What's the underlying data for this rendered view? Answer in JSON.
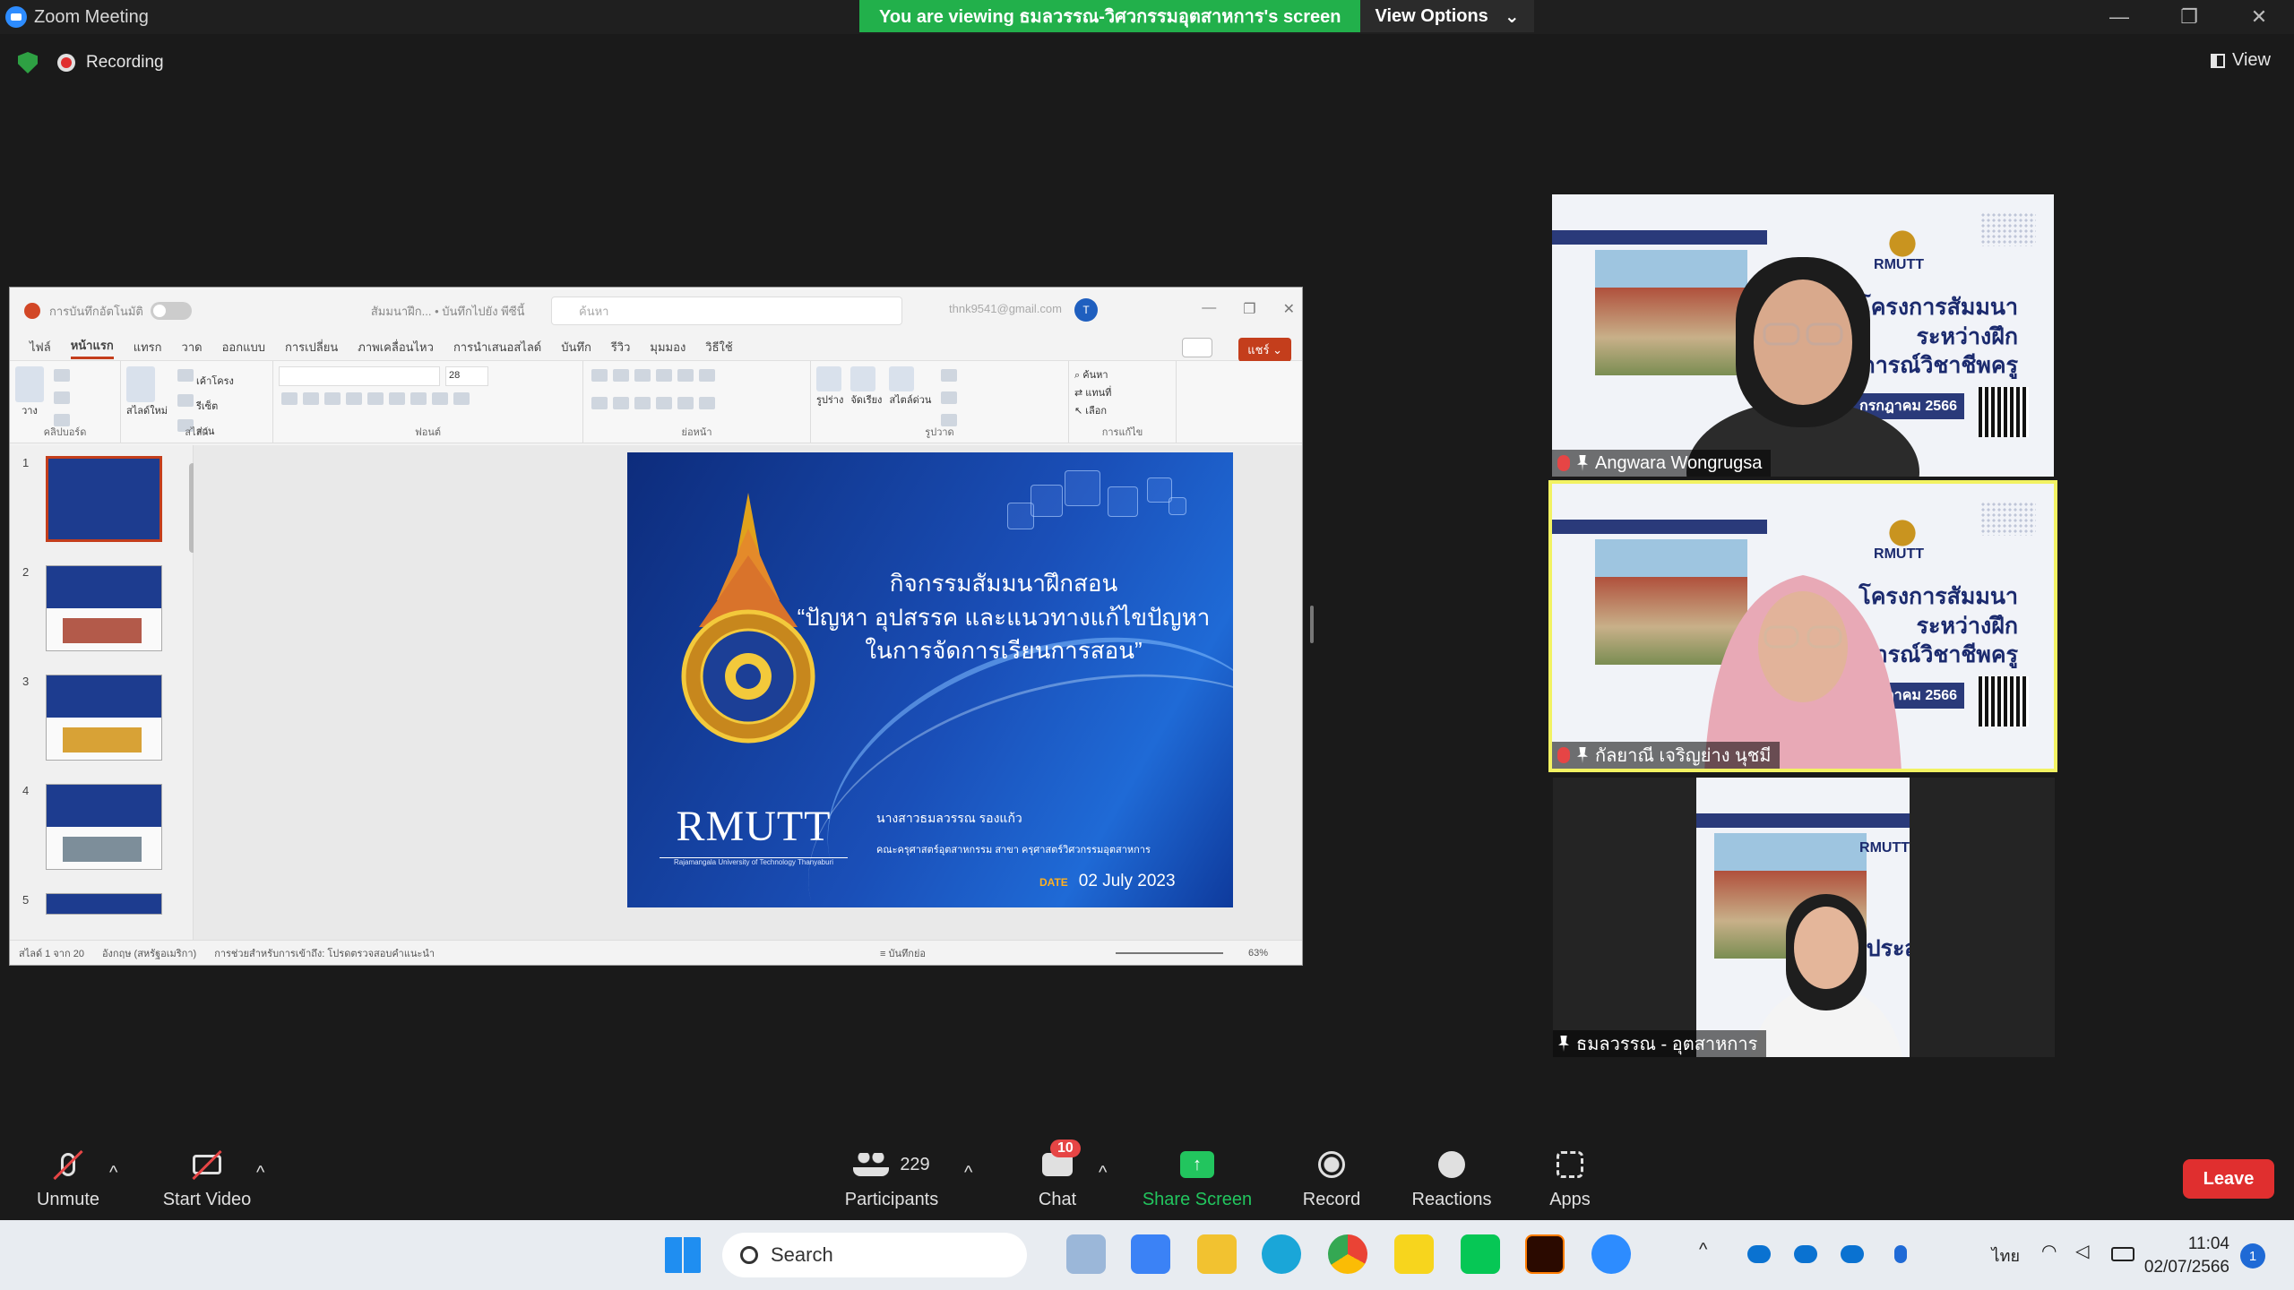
{
  "window": {
    "title": "Zoom Meeting"
  },
  "banner": {
    "viewing_text": "You are viewing ธมลวรรณ-วิศวกรรมอุตสาหการ's screen",
    "view_options": "View Options"
  },
  "recording": {
    "label": "Recording"
  },
  "view_button": {
    "label": "View"
  },
  "ppt": {
    "autosave": "การบันทึกอัตโนมัติ",
    "file": "สัมมนาฝึก... • บันทึกไปยัง พีซีนี้",
    "search_placeholder": "ค้นหา",
    "email": "thnk9541@gmail.com",
    "avatar": "T",
    "tabs": [
      "ไฟล์",
      "หน้าแรก",
      "แทรก",
      "วาด",
      "ออกแบบ",
      "การเปลี่ยน",
      "ภาพเคลื่อนไหว",
      "การนำเสนอสไลด์",
      "บันทึก",
      "รีวิว",
      "มุมมอง",
      "วิธีใช้"
    ],
    "share": "แชร์",
    "ribbon_groups": [
      "คลิปบอร์ด",
      "สไลด์",
      "ฟอนต์",
      "ย่อหน้า",
      "รูปวาด",
      "การแก้ไข"
    ],
    "ribbon": {
      "paste": "วาง",
      "new_slide": "สไลด์ใหม่",
      "layout": "เค้าโครง",
      "reset": "รีเซ็ต",
      "section": "ส่วน",
      "font_size": "28",
      "shapes": "รูปร่าง",
      "arrange": "จัดเรียง",
      "quick_styles": "สไตล์ด่วน",
      "find": "ค้นหา",
      "replace": "แทนที่",
      "select": "เลือก"
    },
    "thumb_numbers": [
      "1",
      "2",
      "3",
      "4",
      "5"
    ],
    "status_left": "สไลด์ 1 จาก 20",
    "status_lang": "อังกฤษ (สหรัฐอเมริกา)",
    "status_access": "การช่วยสำหรับการเข้าถึง: โปรดตรวจสอบคำแนะนำ",
    "status_notes": "บันทึกย่อ",
    "zoom": "63%"
  },
  "slide": {
    "line1": "กิจกรรมสัมมนาฝึกสอน",
    "line2": "“ปัญหา อุปสรรค และแนวทางแก้ไขปัญหา",
    "line3": "ในการจัดการเรียนการสอน”",
    "brand": "RMUTT",
    "brand_sub": "Rajamangala University of Technology Thanyaburi",
    "presenter": "นางสาวธมลวรรณ รองแก้ว",
    "faculty": "คณะครุศาสตร์อุตสาหกรรม  สาขา ครุศาสตร์วิศวกรรมอุตสาหการ",
    "date_label": "DATE",
    "date_value": "02 July 2023"
  },
  "tiles": {
    "bg_logo_text": "RMUTT",
    "bg_text": [
      "โครงการสัมมนา",
      "ระหว่างฝึก",
      "ประสบการณ์วิชาชีพครู"
    ],
    "bg_date": "กรกฎาคม 2566",
    "p1": "Angwara Wongrugsa",
    "p2": "กัลยาณี เจริญย่าง นุชมี",
    "p3": "ธมลวรรณ - อุตสาหการ"
  },
  "toolbar": {
    "unmute": "Unmute",
    "start_video": "Start Video",
    "participants": "Participants",
    "participants_count": "229",
    "chat": "Chat",
    "chat_badge": "10",
    "share_screen": "Share Screen",
    "record": "Record",
    "reactions": "Reactions",
    "apps": "Apps",
    "leave": "Leave"
  },
  "taskbar": {
    "search": "Search",
    "lang": "ไทย",
    "time": "11:04",
    "date": "02/07/2566",
    "notifications": "1"
  },
  "colors": {
    "zoom_green": "#22b04b",
    "leave_red": "#e02f2f",
    "active_speaker": "#f2f262",
    "ppt_accent": "#c43e1c"
  }
}
